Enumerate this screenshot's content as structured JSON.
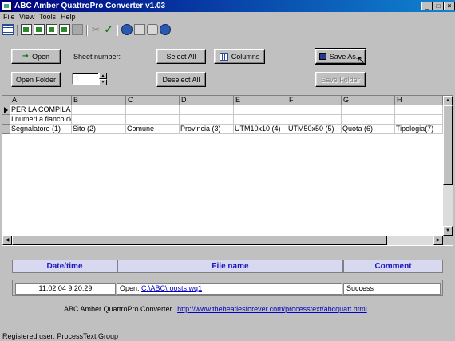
{
  "window": {
    "title": "ABC Amber QuattroPro Converter v1.03",
    "controls": [
      "_",
      "□",
      "×"
    ]
  },
  "menu": [
    "File",
    "View",
    "Tools",
    "Help"
  ],
  "toolbar_icons": [
    "grid-icon",
    "excel-icon",
    "excel-add-icon",
    "export-icon",
    "document-icon",
    "document-gray-icon",
    "tools-icon",
    "spellcheck-icon",
    "info-icon",
    "home-icon",
    "print-icon",
    "help-icon"
  ],
  "controls": {
    "open_label": "Open",
    "open_folder_label": "Open Folder",
    "sheet_number_label": "Sheet number:",
    "sheet_number_value": "1",
    "select_all_label": "Select All",
    "deselect_all_label": "Deselect All",
    "columns_label": "Columns",
    "save_as_label": "Save As...",
    "save_folder_label": "Save Folder"
  },
  "sheet": {
    "columns": [
      "A",
      "B",
      "C",
      "D",
      "E",
      "F",
      "G",
      "H"
    ],
    "rows": [
      [
        "PER LA COMPILAZIO",
        "",
        "",
        "",
        "",
        "",
        "",
        ""
      ],
      [
        "I numeri  a fianco del n",
        "",
        "",
        "",
        "",
        "",
        "",
        ""
      ],
      [
        "Segnalatore (1)",
        "Sito (2)",
        "Comune",
        "Provincia (3)",
        "UTM10x10 (4)",
        "UTM50x50 (5)",
        "Quota (6)",
        "Tipologia(7)"
      ]
    ]
  },
  "log": {
    "headers": {
      "datetime": "Date/time",
      "filename": "File name",
      "comment": "Comment"
    },
    "entry": {
      "datetime": "11.02.04 9:20:29",
      "action": "Open:",
      "path": "C:\\ABC\\roosts.wq1",
      "comment": "Success"
    }
  },
  "footer": {
    "product": "ABC Amber QuattroPro Converter",
    "url": "http://www.thebeatlesforever.com/processtext/abcquatt.html"
  },
  "status": {
    "text": "Registered user: ProcessText Group"
  }
}
